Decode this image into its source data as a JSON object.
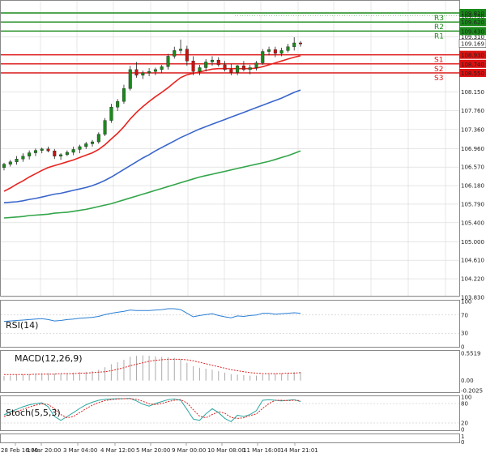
{
  "chart_data": {
    "type": "candlestick",
    "colors": {
      "up": "#1a8a1a",
      "down": "#cc1111",
      "wick": "#222222",
      "ma_red": "#e8231f",
      "ma_blue": "#3a66cc",
      "ma_green": "#33a64a",
      "resistance": "#1a8a1a",
      "support": "#dd1111",
      "grid": "#d7d7d7"
    },
    "price_axis": {
      "ylim": [
        103.83,
        110.0
      ],
      "ticks": [
        "109.810",
        "109.310",
        "108.930",
        "108.540",
        "108.150",
        "107.760",
        "107.360",
        "106.960",
        "106.570",
        "106.180",
        "105.790",
        "105.400",
        "105.000",
        "104.610",
        "104.220",
        "103.830"
      ]
    },
    "levels": [
      {
        "name": "R3",
        "value": 109.81,
        "kind": "resistance",
        "label": "109.810"
      },
      {
        "name": "R2",
        "value": 109.62,
        "kind": "resistance",
        "label": "109.620"
      },
      {
        "name": "R1",
        "value": 109.43,
        "kind": "resistance",
        "label": "109.430"
      },
      {
        "name": "S1",
        "value": 108.93,
        "kind": "support",
        "label": "108.930"
      },
      {
        "name": "S2",
        "value": 108.74,
        "kind": "support",
        "label": "108.740"
      },
      {
        "name": "S3",
        "value": 108.55,
        "kind": "support",
        "label": "108.550"
      }
    ],
    "level_extra_label": "109.750",
    "current_price": {
      "value": 109.169,
      "label": "109.169"
    },
    "x_labels": [
      "28 Feb 16:00",
      "1 Mar 20:00",
      "3 Mar 04:00",
      "4 Mar 12:00",
      "5 Mar 20:00",
      "9 Mar 00:00",
      "10 Mar 08:00",
      "11 Mar 16:00",
      "14 Mar 21:01"
    ],
    "candles": [
      [
        106.56,
        106.66,
        106.5,
        106.63
      ],
      [
        106.63,
        106.72,
        106.58,
        106.68
      ],
      [
        106.68,
        106.8,
        106.62,
        106.74
      ],
      [
        106.74,
        106.86,
        106.68,
        106.8
      ],
      [
        106.8,
        106.92,
        106.73,
        106.87
      ],
      [
        106.87,
        106.96,
        106.8,
        106.92
      ],
      [
        106.92,
        106.98,
        106.86,
        106.95
      ],
      [
        106.95,
        107.0,
        106.88,
        106.91
      ],
      [
        106.91,
        106.95,
        106.74,
        106.8
      ],
      [
        106.8,
        106.86,
        106.72,
        106.83
      ],
      [
        106.83,
        106.92,
        106.8,
        106.88
      ],
      [
        106.88,
        107.0,
        106.82,
        106.94
      ],
      [
        106.94,
        107.04,
        106.86,
        107.0
      ],
      [
        107.0,
        107.1,
        106.95,
        107.06
      ],
      [
        107.06,
        107.14,
        107.0,
        107.1
      ],
      [
        107.1,
        107.3,
        107.06,
        107.26
      ],
      [
        107.26,
        107.6,
        107.22,
        107.55
      ],
      [
        107.55,
        107.9,
        107.5,
        107.83
      ],
      [
        107.83,
        108.0,
        107.75,
        107.95
      ],
      [
        107.95,
        108.3,
        107.9,
        108.22
      ],
      [
        108.22,
        108.7,
        108.18,
        108.62
      ],
      [
        108.62,
        108.78,
        108.45,
        108.5
      ],
      [
        108.5,
        108.6,
        108.42,
        108.55
      ],
      [
        108.55,
        108.65,
        108.48,
        108.58
      ],
      [
        108.58,
        108.66,
        108.5,
        108.62
      ],
      [
        108.62,
        108.72,
        108.55,
        108.68
      ],
      [
        108.68,
        108.95,
        108.62,
        108.9
      ],
      [
        108.9,
        109.1,
        108.85,
        109.02
      ],
      [
        109.02,
        109.25,
        108.95,
        109.05
      ],
      [
        109.05,
        109.12,
        108.7,
        108.8
      ],
      [
        108.8,
        108.9,
        108.5,
        108.58
      ],
      [
        108.58,
        108.72,
        108.5,
        108.66
      ],
      [
        108.66,
        108.84,
        108.58,
        108.78
      ],
      [
        108.78,
        108.9,
        108.7,
        108.82
      ],
      [
        108.82,
        108.88,
        108.68,
        108.72
      ],
      [
        108.72,
        108.8,
        108.58,
        108.62
      ],
      [
        108.62,
        108.74,
        108.5,
        108.56
      ],
      [
        108.56,
        108.72,
        108.5,
        108.7
      ],
      [
        108.7,
        108.8,
        108.58,
        108.62
      ],
      [
        108.62,
        108.72,
        108.52,
        108.66
      ],
      [
        108.66,
        108.8,
        108.6,
        108.76
      ],
      [
        108.76,
        109.05,
        108.72,
        109.0
      ],
      [
        109.0,
        109.1,
        108.92,
        109.04
      ],
      [
        109.04,
        109.1,
        108.88,
        108.96
      ],
      [
        108.96,
        109.08,
        108.9,
        109.02
      ],
      [
        109.02,
        109.16,
        108.98,
        109.1
      ],
      [
        109.1,
        109.3,
        109.02,
        109.18
      ],
      [
        109.18,
        109.22,
        109.1,
        109.16
      ]
    ],
    "ma_red": [
      106.06,
      106.13,
      106.21,
      106.28,
      106.36,
      106.43,
      106.5,
      106.56,
      106.6,
      106.64,
      106.68,
      106.72,
      106.77,
      106.82,
      106.87,
      106.94,
      107.04,
      107.16,
      107.28,
      107.42,
      107.58,
      107.72,
      107.84,
      107.95,
      108.05,
      108.14,
      108.24,
      108.35,
      108.45,
      108.51,
      108.54,
      108.57,
      108.6,
      108.63,
      108.64,
      108.64,
      108.64,
      108.64,
      108.64,
      108.64,
      108.65,
      108.68,
      108.72,
      108.76,
      108.8,
      108.84,
      108.88,
      108.91
    ],
    "ma_blue": [
      105.82,
      105.83,
      105.84,
      105.86,
      105.89,
      105.91,
      105.94,
      105.97,
      106.0,
      106.02,
      106.05,
      106.08,
      106.11,
      106.14,
      106.18,
      106.23,
      106.29,
      106.36,
      106.44,
      106.52,
      106.6,
      106.68,
      106.76,
      106.83,
      106.91,
      106.98,
      107.05,
      107.12,
      107.19,
      107.25,
      107.31,
      107.37,
      107.42,
      107.47,
      107.52,
      107.57,
      107.62,
      107.67,
      107.72,
      107.77,
      107.82,
      107.87,
      107.92,
      107.97,
      108.02,
      108.08,
      108.14,
      108.19
    ],
    "ma_green": [
      105.5,
      105.51,
      105.52,
      105.53,
      105.55,
      105.56,
      105.57,
      105.58,
      105.6,
      105.61,
      105.62,
      105.64,
      105.66,
      105.68,
      105.71,
      105.74,
      105.77,
      105.8,
      105.84,
      105.88,
      105.92,
      105.96,
      106.0,
      106.04,
      106.08,
      106.12,
      106.16,
      106.2,
      106.24,
      106.28,
      106.32,
      106.36,
      106.39,
      106.42,
      106.45,
      106.48,
      106.51,
      106.54,
      106.57,
      106.6,
      106.63,
      106.66,
      106.69,
      106.73,
      106.77,
      106.81,
      106.86,
      106.91
    ],
    "rsi": {
      "label": "RSI(14)",
      "ticks": [
        "100",
        "70",
        "30",
        "0"
      ],
      "values": [
        56,
        57,
        58,
        59,
        60,
        61,
        62,
        60,
        57,
        58,
        60,
        61,
        63,
        64,
        65,
        67,
        71,
        74,
        76,
        78,
        81,
        80,
        80,
        80,
        81,
        82,
        84,
        84,
        82,
        74,
        66,
        69,
        71,
        73,
        69,
        66,
        64,
        68,
        67,
        69,
        70,
        74,
        74,
        72,
        73,
        74,
        75,
        74
      ]
    },
    "macd": {
      "label": "MACD(12,26,9)",
      "ticks": [
        "0.5519",
        "0.00",
        "-0.2025"
      ],
      "hist": [
        0.09,
        0.1,
        0.11,
        0.12,
        0.13,
        0.14,
        0.15,
        0.15,
        0.14,
        0.14,
        0.15,
        0.16,
        0.17,
        0.18,
        0.19,
        0.22,
        0.27,
        0.33,
        0.37,
        0.42,
        0.48,
        0.5,
        0.51,
        0.5,
        0.49,
        0.48,
        0.47,
        0.46,
        0.43,
        0.36,
        0.29,
        0.26,
        0.24,
        0.22,
        0.19,
        0.16,
        0.13,
        0.12,
        0.11,
        0.1,
        0.1,
        0.12,
        0.13,
        0.14,
        0.15,
        0.16,
        0.17,
        0.17
      ],
      "signal": [
        0.12,
        0.12,
        0.12,
        0.12,
        0.12,
        0.13,
        0.13,
        0.13,
        0.13,
        0.14,
        0.14,
        0.14,
        0.15,
        0.15,
        0.16,
        0.17,
        0.18,
        0.2,
        0.23,
        0.26,
        0.3,
        0.33,
        0.36,
        0.39,
        0.41,
        0.42,
        0.43,
        0.43,
        0.43,
        0.42,
        0.4,
        0.37,
        0.34,
        0.31,
        0.28,
        0.25,
        0.22,
        0.2,
        0.18,
        0.16,
        0.15,
        0.14,
        0.14,
        0.14,
        0.14,
        0.15,
        0.15,
        0.16
      ]
    },
    "stoch": {
      "label": "Stoch(5,5,3)",
      "ticks": [
        "100",
        "80",
        "20",
        "0"
      ],
      "k": [
        45,
        55,
        62,
        70,
        76,
        80,
        82,
        70,
        40,
        28,
        40,
        52,
        65,
        76,
        84,
        90,
        93,
        94,
        95,
        95,
        96,
        88,
        78,
        72,
        80,
        86,
        92,
        94,
        90,
        62,
        32,
        28,
        48,
        64,
        52,
        34,
        24,
        44,
        40,
        46,
        58,
        90,
        92,
        90,
        88,
        90,
        92,
        86
      ],
      "d": [
        40,
        48,
        55,
        62,
        69,
        75,
        79,
        77,
        64,
        46,
        36,
        40,
        52,
        64,
        75,
        83,
        89,
        92,
        94,
        95,
        95,
        93,
        87,
        79,
        77,
        80,
        86,
        90,
        92,
        82,
        61,
        41,
        36,
        46,
        55,
        50,
        37,
        34,
        36,
        43,
        48,
        65,
        80,
        90,
        90,
        89,
        90,
        89
      ]
    },
    "blank_panel_ticks": [
      "1",
      "0"
    ]
  }
}
